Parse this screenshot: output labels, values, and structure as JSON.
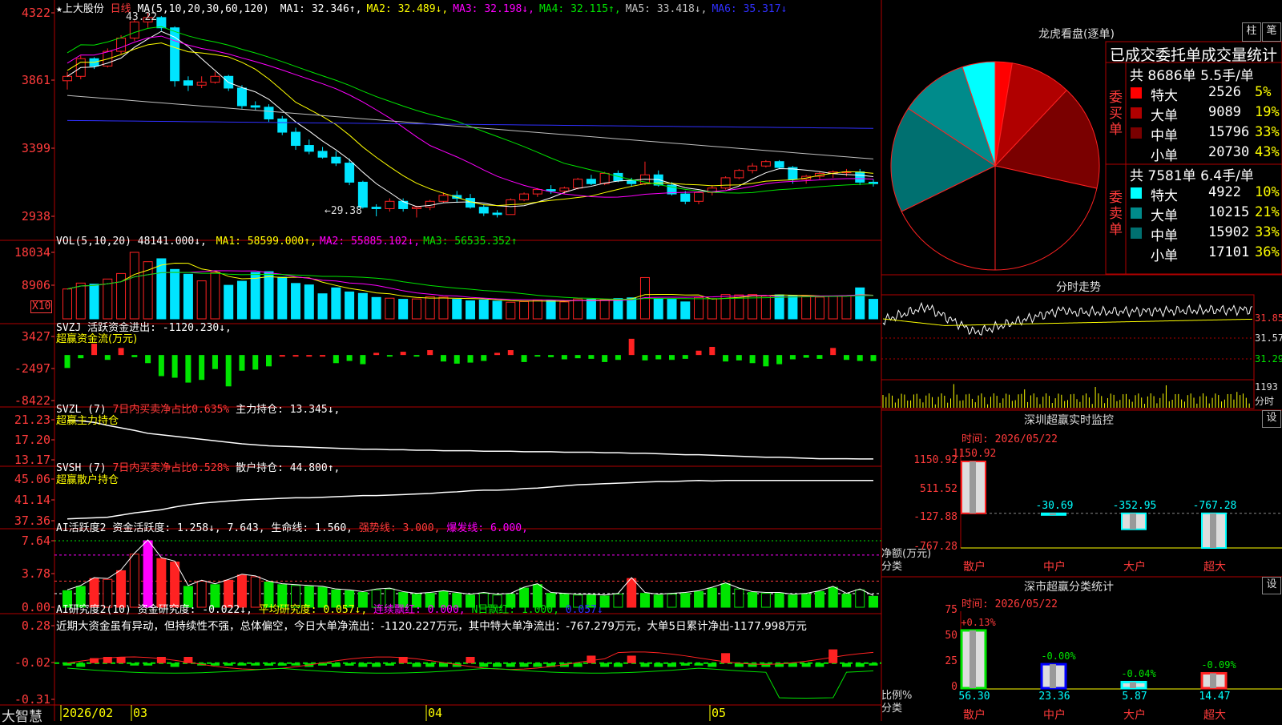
{
  "colors": {
    "up": "#ff2222",
    "down": "#00e5ff",
    "grid": "#b00000",
    "green": "#00e500",
    "yellow": "#ffff00",
    "magenta": "#ff00ff",
    "teal": "#008b8b",
    "dark_red": "#8b0000"
  },
  "header": {
    "stock": "★上大股份",
    "period": "日线",
    "ma_label": "MA(5,10,20,30,60,120)",
    "ma": [
      {
        "label": "MA1: 32.346↑,",
        "color": "#ffffff"
      },
      {
        "label": "MA2: 32.489↓,",
        "color": "#ffff00"
      },
      {
        "label": "MA3: 32.198↓,",
        "color": "#ff00ff"
      },
      {
        "label": "MA4: 32.115↑,",
        "color": "#00e500"
      },
      {
        "label": "MA5: 33.418↓,",
        "color": "#c0c0c0"
      },
      {
        "label": "MA6: 35.317↓",
        "color": "#3030ff"
      }
    ],
    "hi_label": "43.22",
    "lo_label": "←29.38"
  },
  "axes": {
    "price": [
      "4322",
      "3861",
      "3399",
      "2938"
    ],
    "vol": [
      "18034",
      "8906"
    ],
    "vol_unit": "X10",
    "svzj": [
      "3427",
      "-2497",
      "-8422"
    ],
    "svzl": [
      "21.23",
      "17.20",
      "13.17"
    ],
    "svsh": [
      "45.06",
      "41.14",
      "37.36"
    ],
    "ai": [
      "7.64",
      "3.78",
      "0.00"
    ],
    "ai2": [
      "0.28",
      "-0.02",
      "-0.31"
    ]
  },
  "vol": {
    "label": "VOL(5,10,20)",
    "value": "48141.000↓,",
    "ma": [
      {
        "label": "MA1: 58599.000↑,",
        "color": "#ffff00"
      },
      {
        "label": "MA2: 55885.102↓,",
        "color": "#ff00ff"
      },
      {
        "label": "MA3: 56535.352↑",
        "color": "#00e500"
      }
    ]
  },
  "svzj": {
    "label": "SVZJ",
    "title": "活跃资金进出: -1120.230↓,",
    "subtitle": "超赢资金流(万元)"
  },
  "svzl": {
    "label": "SVZL (7)",
    "stat": "7日内买卖净占比0.635%",
    "value": "主力持仓: 13.345↓,",
    "subtitle": "超赢主力持仓"
  },
  "svsh": {
    "label": "SVSH (7)",
    "stat": "7日内买卖净占比0.528%",
    "value": "散户持仓: 44.800↑,",
    "subtitle": "超赢散户持仓"
  },
  "ai": {
    "label": "AI活跃度2",
    "v1": "资金活跃度: 1.258↓,",
    "v2": "7.643,",
    "v3": "生命线: 1.560,",
    "v4": "强势线: 3.000,",
    "v5": "爆发线: 6.000,"
  },
  "ai2": {
    "label": "AI研究度2(10)",
    "v1": "资金研究度: -0.022↓,",
    "v2": "平均研究度: 0.057↓,",
    "v3": "连续飘红: 0.000,",
    "v4": "N日飘红: 1.000,",
    "v5": "0.057↓",
    "summary": "近期大资金虽有异动，但持续性不强，总体偏空，今日大单净流出：-1120.227万元，其中特大单净流出：-767.279万元，大单5日累计净出-1177.998万元"
  },
  "xaxis": {
    "brand": "大智慧",
    "labels": [
      {
        "text": "2026/02",
        "color": "#ffff00"
      },
      {
        "text": "03",
        "color": "#ffff00"
      },
      {
        "text": "04",
        "color": "#ffff00"
      },
      {
        "text": "05",
        "color": "#ffff00"
      }
    ]
  },
  "dragon": {
    "title": "龙虎看盘(逐单)",
    "btn_column": "柱",
    "btn_pen": "笔",
    "stat_title": "已成交委托单成交量统计",
    "buy_label": "委买单",
    "sell_label": "委卖单",
    "buy_total": "共 8686单 5.5手/单",
    "sell_total": "共 7581单 6.4手/单",
    "buy": [
      {
        "name": "特大",
        "vol": "2526",
        "pct": "5%",
        "color": "#ff0000"
      },
      {
        "name": "大单",
        "vol": "9089",
        "pct": "19%",
        "color": "#b00000"
      },
      {
        "name": "中单",
        "vol": "15796",
        "pct": "33%",
        "color": "#7a0000"
      },
      {
        "name": "小单",
        "vol": "20730",
        "pct": "43%",
        "color": "#000000"
      }
    ],
    "sell": [
      {
        "name": "特大",
        "vol": "4922",
        "pct": "10%",
        "color": "#00ffff"
      },
      {
        "name": "大单",
        "vol": "10215",
        "pct": "21%",
        "color": "#008b8b"
      },
      {
        "name": "中单",
        "vol": "15902",
        "pct": "33%",
        "color": "#007070"
      },
      {
        "name": "小单",
        "vol": "17101",
        "pct": "36%",
        "color": "#000000"
      }
    ]
  },
  "intraday": {
    "title": "分时走势",
    "prices": [
      "31.85",
      "31.57",
      "31.29"
    ],
    "vol_label": "1193",
    "vol_unit": "分时"
  },
  "sz_monitor": {
    "title": "深圳超赢实时监控",
    "btn": "设",
    "date": "时间: 2026/05/22",
    "yaxis": [
      "1150.92",
      "511.52",
      "-127.88",
      "-767.28"
    ],
    "ylabel1": "净额(万元)",
    "ylabel2": "分类",
    "categories": [
      "散户",
      "中户",
      "大户",
      "超大"
    ],
    "values": [
      1150.92,
      -30.69,
      -352.95,
      -767.28
    ],
    "value_labels": [
      "1150.92",
      "-30.69",
      "-352.95",
      "-767.28"
    ]
  },
  "sz_class": {
    "title": "深市超赢分类统计",
    "btn": "设",
    "date": "时间: 2026/05/22",
    "yaxis": [
      "75",
      "50",
      "25",
      "0"
    ],
    "ylabel1": "比例%",
    "ylabel2": "分类",
    "categories": [
      "散户",
      "中户",
      "大户",
      "超大"
    ],
    "values": [
      56.3,
      23.36,
      5.87,
      14.47
    ],
    "value_labels": [
      "56.30",
      "23.36",
      "5.87",
      "14.47"
    ],
    "change_labels": [
      "+0.13%",
      "-0.00%",
      "-0.04%",
      "-0.09%"
    ],
    "colors": [
      "#00e500",
      "#0000ff",
      "#00ffff",
      "#ff2222"
    ]
  },
  "chart_data": [
    {
      "type": "candlestick",
      "title": "上大股份 日线",
      "ylim": [
        29.38,
        43.22
      ],
      "x_labels": [
        "2026/02",
        "03",
        "04",
        "05"
      ],
      "ohlc": [
        [
          38.6,
          39.2,
          38.0,
          38.9
        ],
        [
          38.9,
          40.3,
          38.7,
          40.1
        ],
        [
          40.1,
          40.2,
          39.4,
          39.6
        ],
        [
          39.6,
          40.8,
          39.5,
          40.6
        ],
        [
          40.6,
          41.7,
          40.4,
          41.5
        ],
        [
          41.5,
          42.8,
          41.3,
          42.6
        ],
        [
          42.6,
          43.22,
          42.2,
          42.9
        ],
        [
          42.9,
          43.0,
          42.0,
          42.2
        ],
        [
          42.2,
          42.3,
          38.2,
          38.6
        ],
        [
          38.6,
          38.9,
          37.9,
          38.3
        ],
        [
          38.3,
          38.9,
          38.1,
          38.5
        ],
        [
          38.5,
          39.2,
          38.4,
          38.9
        ],
        [
          38.9,
          39.0,
          37.9,
          38.1
        ],
        [
          38.1,
          38.3,
          36.7,
          36.9
        ],
        [
          36.9,
          37.2,
          36.6,
          36.8
        ],
        [
          36.8,
          37.0,
          35.8,
          36.0
        ],
        [
          36.0,
          36.2,
          34.9,
          35.1
        ],
        [
          35.1,
          35.4,
          33.9,
          34.2
        ],
        [
          34.2,
          34.6,
          33.6,
          33.8
        ],
        [
          33.8,
          34.1,
          33.3,
          33.4
        ],
        [
          33.4,
          33.8,
          32.8,
          33.0
        ],
        [
          33.0,
          33.3,
          31.5,
          31.7
        ],
        [
          31.7,
          31.8,
          29.9,
          30.0
        ],
        [
          30.0,
          30.2,
          29.38,
          29.9
        ],
        [
          29.9,
          30.6,
          29.7,
          30.4
        ],
        [
          30.4,
          30.6,
          29.7,
          29.9
        ],
        [
          29.9,
          30.1,
          29.3,
          30.0
        ],
        [
          30.0,
          30.5,
          29.8,
          30.4
        ],
        [
          30.4,
          31.0,
          30.3,
          30.8
        ],
        [
          30.8,
          31.1,
          30.3,
          30.6
        ],
        [
          30.6,
          30.9,
          29.9,
          30.0
        ],
        [
          30.0,
          30.2,
          29.4,
          29.6
        ],
        [
          29.6,
          29.8,
          29.3,
          29.5
        ],
        [
          29.5,
          30.6,
          29.5,
          30.5
        ],
        [
          30.5,
          31.0,
          30.4,
          30.9
        ],
        [
          30.9,
          31.3,
          30.7,
          31.2
        ],
        [
          31.2,
          31.5,
          30.9,
          31.1
        ],
        [
          31.1,
          31.4,
          30.9,
          31.3
        ],
        [
          31.3,
          32.0,
          31.2,
          31.9
        ],
        [
          31.9,
          32.2,
          31.5,
          31.6
        ],
        [
          31.6,
          32.4,
          31.5,
          32.3
        ],
        [
          32.3,
          32.5,
          31.7,
          31.8
        ],
        [
          31.8,
          32.0,
          31.4,
          31.6
        ],
        [
          31.6,
          33.1,
          31.5,
          32.2
        ],
        [
          32.2,
          32.5,
          31.4,
          31.5
        ],
        [
          31.5,
          31.7,
          30.8,
          30.9
        ],
        [
          30.9,
          31.1,
          30.2,
          30.4
        ],
        [
          30.4,
          31.1,
          30.2,
          31.0
        ],
        [
          31.0,
          31.5,
          30.8,
          31.3
        ],
        [
          31.3,
          32.1,
          31.2,
          32.0
        ],
        [
          32.0,
          32.6,
          31.9,
          32.5
        ],
        [
          32.5,
          33.0,
          32.3,
          32.8
        ],
        [
          32.8,
          33.2,
          32.7,
          33.1
        ],
        [
          33.1,
          33.2,
          32.6,
          32.7
        ],
        [
          32.7,
          32.8,
          31.6,
          31.9
        ],
        [
          31.9,
          32.2,
          31.6,
          32.1
        ],
        [
          32.1,
          32.4,
          31.9,
          32.3
        ],
        [
          32.3,
          32.5,
          32.0,
          32.4
        ],
        [
          32.4,
          32.6,
          32.1,
          32.4
        ],
        [
          32.4,
          32.6,
          31.5,
          31.7
        ],
        [
          31.7,
          31.9,
          31.4,
          31.6
        ]
      ]
    },
    {
      "type": "bar",
      "title": "VOL(5,10,20)",
      "ylim": [
        0,
        18034
      ],
      "values": [
        8100,
        9700,
        9400,
        10800,
        12300,
        18034,
        15500,
        16300,
        13400,
        12100,
        10300,
        12600,
        9100,
        10200,
        12600,
        12800,
        11300,
        9600,
        9200,
        6800,
        8400,
        7300,
        6900,
        5800,
        5600,
        5300,
        5400,
        6000,
        5900,
        5300,
        4900,
        5100,
        4800,
        4500,
        4700,
        5100,
        5000,
        4600,
        5400,
        5300,
        5200,
        5500,
        5700,
        11200,
        5500,
        5300,
        4600,
        5800,
        5500,
        6600,
        6500,
        6600,
        6200,
        6500,
        6300,
        6200,
        5900,
        6100,
        6300,
        8400,
        5300
      ]
    },
    {
      "type": "bar",
      "title": "SVZJ 活跃资金进出",
      "ylim": [
        -8422,
        3427
      ],
      "values": [
        -2400,
        -600,
        2100,
        -900,
        1300,
        -400,
        -1500,
        -3900,
        -4200,
        -5100,
        -4600,
        -2600,
        -5800,
        -2900,
        -2700,
        -2100,
        0,
        0,
        0,
        0,
        -1500,
        -1100,
        -1700,
        400,
        -200,
        600,
        -200,
        900,
        -1200,
        -1600,
        -1400,
        -1100,
        400,
        900,
        -1300,
        -200,
        -400,
        -800,
        -600,
        -700,
        -1300,
        -900,
        3000,
        -1000,
        -800,
        -900,
        -700,
        800,
        1500,
        -1200,
        -1000,
        -1500,
        -2100,
        -1700,
        -800,
        -500,
        -700,
        1300,
        -900,
        -1100,
        -1120.23
      ]
    },
    {
      "type": "line",
      "title": "SVZL 主力持仓",
      "ylim": [
        13.17,
        21.23
      ],
      "values": [
        21.1,
        21.0,
        20.7,
        20.1,
        19.6,
        19.1,
        18.5,
        18.2,
        17.9,
        17.6,
        17.3,
        17.0,
        16.7,
        16.4,
        16.2,
        16.0,
        15.9,
        15.8,
        15.7,
        15.6,
        15.5,
        15.4,
        15.3,
        15.3,
        15.2,
        15.2,
        15.1,
        15.1,
        15.0,
        15.0,
        15.0,
        14.9,
        14.9,
        14.9,
        14.8,
        14.8,
        14.8,
        14.7,
        14.7,
        14.7,
        14.6,
        14.6,
        14.5,
        14.5,
        14.4,
        14.3,
        14.2,
        14.2,
        14.1,
        14.0,
        13.9,
        13.8,
        13.7,
        13.7,
        13.6,
        13.5,
        13.4,
        13.4,
        13.4,
        13.35,
        13.345
      ]
    },
    {
      "type": "line",
      "title": "SVSH 散户持仓",
      "ylim": [
        37.36,
        45.06
      ],
      "values": [
        37.7,
        37.8,
        37.9,
        38.0,
        38.4,
        38.8,
        39.1,
        39.4,
        39.9,
        40.3,
        40.6,
        40.8,
        41.0,
        41.2,
        41.3,
        41.4,
        41.5,
        41.6,
        41.6,
        41.7,
        41.8,
        41.9,
        42.0,
        42.0,
        42.1,
        42.2,
        42.3,
        42.4,
        42.6,
        42.7,
        42.9,
        43.0,
        43.0,
        43.1,
        43.3,
        43.4,
        43.6,
        43.8,
        44.0,
        44.1,
        44.2,
        44.3,
        44.4,
        44.5,
        44.6,
        44.6,
        44.7,
        44.8,
        44.7,
        44.8,
        44.8,
        44.8,
        44.8,
        44.8,
        44.8,
        44.8,
        44.8,
        44.8,
        44.8,
        44.8,
        44.8
      ]
    },
    {
      "type": "bar",
      "title": "AI活跃度2",
      "ylim": [
        0,
        7.64
      ],
      "values": [
        1.9,
        2.4,
        3.3,
        3.2,
        4.2,
        6.1,
        7.64,
        5.6,
        5.2,
        2.4,
        3.0,
        2.6,
        3.1,
        3.7,
        3.5,
        2.9,
        2.6,
        2.5,
        2.4,
        2.3,
        2.0,
        1.9,
        1.7,
        2.0,
        2.1,
        1.7,
        1.5,
        1.6,
        1.8,
        1.6,
        1.4,
        1.6,
        1.4,
        1.5,
        2.2,
        2.6,
        1.6,
        1.5,
        1.4,
        1.4,
        1.3,
        1.5,
        3.3,
        1.6,
        1.4,
        1.5,
        1.6,
        1.8,
        2.2,
        2.7,
        2.1,
        1.7,
        1.6,
        1.6,
        1.4,
        1.5,
        1.8,
        2.3,
        1.5,
        2.0,
        1.258
      ]
    },
    {
      "type": "bar",
      "title": "AI研究度2(10)",
      "ylim": [
        -0.31,
        0.28
      ],
      "values": [
        -0.02,
        -0.05,
        0.02,
        0.03,
        0.03,
        -0.03,
        -0.02,
        0.03,
        -0.05,
        0.03,
        -0.02,
        -0.04,
        -0.04,
        -0.03,
        -0.03,
        -0.04,
        -0.04,
        -0.03,
        -0.05,
        -0.03,
        -0.05,
        -0.04,
        -0.05,
        -0.05,
        -0.04,
        0.03,
        -0.05,
        -0.05,
        -0.05,
        -0.05,
        0.03,
        -0.05,
        -0.05,
        -0.05,
        -0.05,
        -0.05,
        -0.05,
        -0.05,
        -0.05,
        0.04,
        -0.05,
        -0.05,
        0.04,
        -0.05,
        -0.05,
        -0.05,
        -0.04,
        -0.03,
        -0.05,
        0.06,
        -0.05,
        -0.05,
        -0.05,
        -0.05,
        -0.05,
        -0.05,
        -0.05,
        0.09,
        -0.05,
        -0.05,
        -0.022
      ]
    },
    {
      "type": "pie",
      "title": "龙虎看盘(逐单)",
      "labels": [
        "委买单特大",
        "委买单大单",
        "委买单中单",
        "委买单小单",
        "委卖单特大",
        "委卖单大单",
        "委卖单中单",
        "委卖单小单"
      ],
      "values": [
        2526,
        9089,
        15796,
        20730,
        4922,
        10215,
        15902,
        17101
      ]
    },
    {
      "type": "bar",
      "title": "深圳超赢实时监控",
      "categories": [
        "散户",
        "中户",
        "大户",
        "超大"
      ],
      "values": [
        1150.92,
        -30.69,
        -352.95,
        -767.28
      ],
      "ylim": [
        -767.28,
        1150.92
      ]
    },
    {
      "type": "bar",
      "title": "深市超赢分类统计",
      "categories": [
        "散户",
        "中户",
        "大户",
        "超大"
      ],
      "values": [
        56.3,
        23.36,
        5.87,
        14.47
      ],
      "ylim": [
        0,
        75
      ]
    }
  ]
}
